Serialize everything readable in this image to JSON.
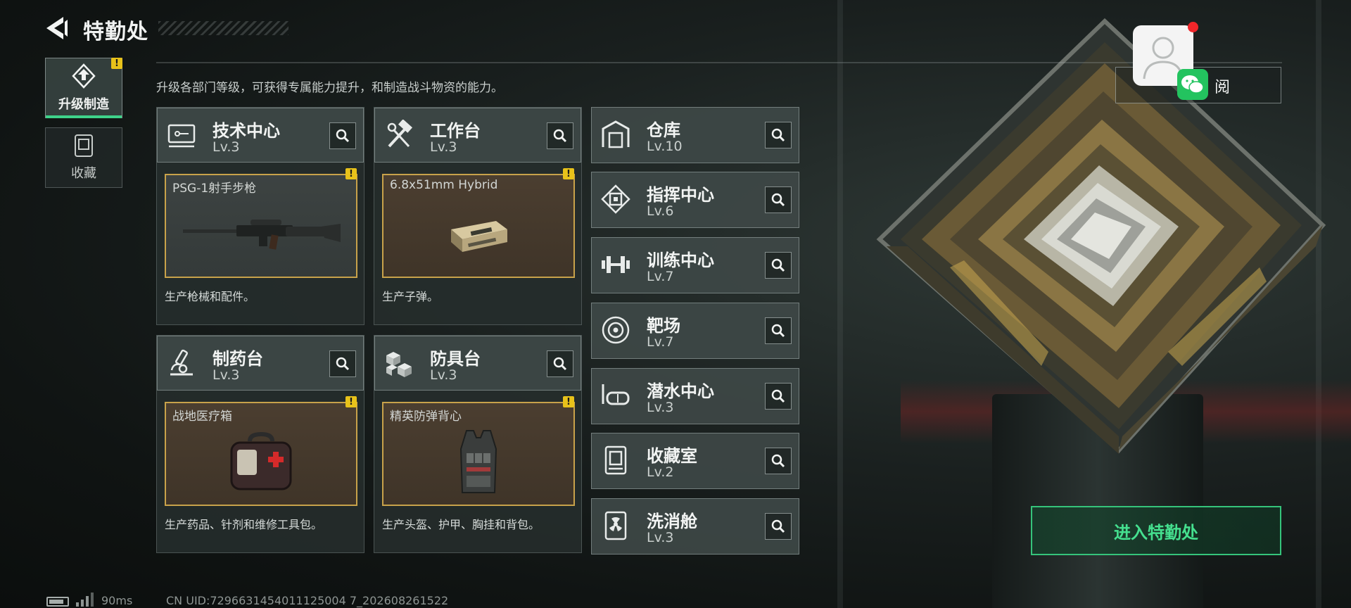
{
  "header": {
    "title": "特勤处",
    "subtitle": "升级各部门等级，可获得专属能力提升，和制造战斗物资的能力。"
  },
  "sidebar": {
    "items": [
      {
        "label": "升级制造",
        "icon": "upgrade-icon",
        "active": true,
        "alert": "!"
      },
      {
        "label": "收藏",
        "icon": "collection-icon",
        "active": false
      }
    ]
  },
  "facilities": [
    {
      "name": "技术中心",
      "level": "Lv.3",
      "icon": "tech-center-icon",
      "product": "PSG-1射手步枪",
      "desc": "生产枪械和配件。",
      "alert": "!"
    },
    {
      "name": "工作台",
      "level": "Lv.3",
      "icon": "workbench-icon",
      "product": "6.8x51mm Hybrid",
      "desc": "生产子弹。",
      "alert": "!"
    },
    {
      "name": "制药台",
      "level": "Lv.3",
      "icon": "pharmacy-icon",
      "product": "战地医疗箱",
      "desc": "生产药品、针剂和维修工具包。",
      "alert": "!"
    },
    {
      "name": "防具台",
      "level": "Lv.3",
      "icon": "armor-bench-icon",
      "product": "精英防弹背心",
      "desc": "生产头盔、护甲、胸挂和背包。",
      "alert": "!"
    }
  ],
  "rooms": [
    {
      "name": "仓库",
      "level": "Lv.10",
      "icon": "warehouse-icon"
    },
    {
      "name": "指挥中心",
      "level": "Lv.6",
      "icon": "command-center-icon"
    },
    {
      "name": "训练中心",
      "level": "Lv.7",
      "icon": "training-center-icon"
    },
    {
      "name": "靶场",
      "level": "Lv.7",
      "icon": "shooting-range-icon"
    },
    {
      "name": "潜水中心",
      "level": "Lv.3",
      "icon": "diving-center-icon"
    },
    {
      "name": "收藏室",
      "level": "Lv.2",
      "icon": "collection-room-icon"
    },
    {
      "name": "洗消舱",
      "level": "Lv.3",
      "icon": "decontamination-icon"
    }
  ],
  "subscribe": {
    "label": "阅"
  },
  "enter_button": {
    "label": "进入特勤处"
  },
  "status": {
    "ping": "90ms",
    "uid": "CN UID:7296631454011125004 7_202608261522"
  },
  "colors": {
    "accent_green": "#35c47b",
    "alert_yellow": "#e8c21a",
    "item_border": "#c8a24a",
    "notif_red": "#f0262a"
  }
}
